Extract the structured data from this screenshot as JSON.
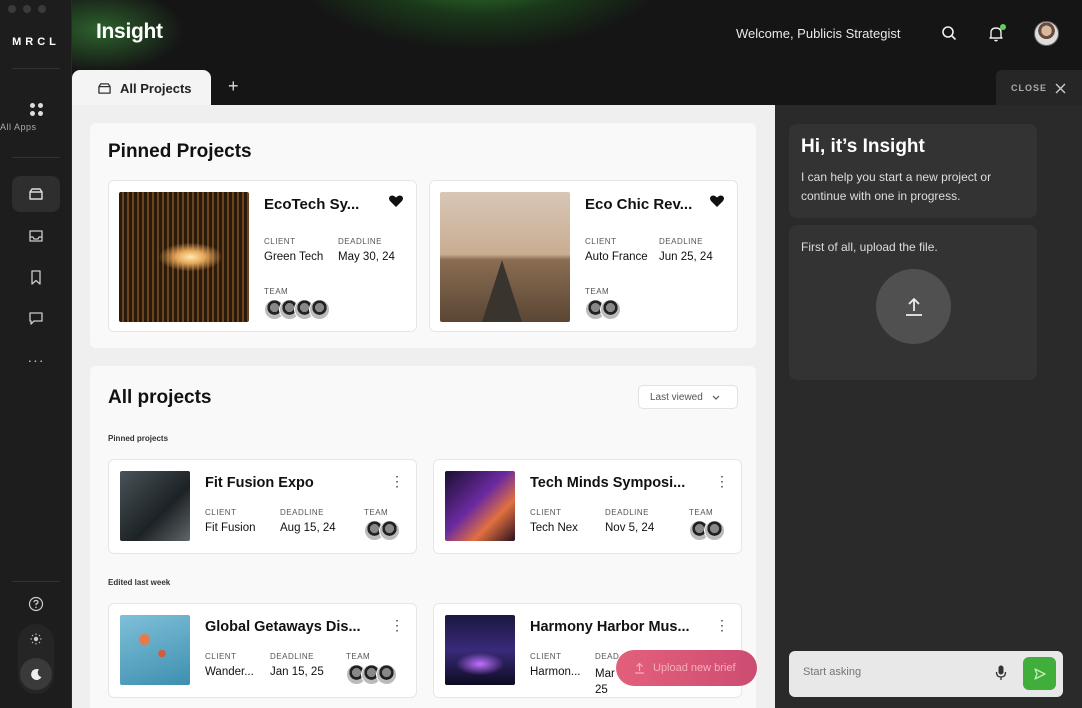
{
  "app": {
    "logo": "MRCL",
    "title": "Insight",
    "welcome": "Welcome, Publicis Strategist"
  },
  "sidebar": {
    "all_apps_label": "All Apps"
  },
  "tabs": {
    "active_label": "All Projects",
    "add_label": "+",
    "close_label": "CLOSE"
  },
  "pinned": {
    "heading": "Pinned Projects",
    "cards": [
      {
        "name": "EcoTech Sy...",
        "client_label": "CLIENT",
        "client": "Green Tech",
        "deadline_label": "DEADLINE",
        "deadline": "May 30, 24",
        "team_label": "TEAM"
      },
      {
        "name": "Eco Chic Rev...",
        "client_label": "CLIENT",
        "client": "Auto France",
        "deadline_label": "DEADLINE",
        "deadline": "Jun 25, 24",
        "team_label": "TEAM"
      }
    ]
  },
  "all_projects": {
    "heading": "All projects",
    "sort_label": "Last viewed",
    "pinned_section_label": "Pinned projects",
    "edited_section_label": "Edited last week",
    "cards": [
      {
        "name": "Fit Fusion Expo",
        "client_label": "CLIENT",
        "client": "Fit Fusion",
        "deadline_label": "DEADLINE",
        "deadline": "Aug 15, 24",
        "team_label": "TEAM"
      },
      {
        "name": "Tech Minds Symposi...",
        "client_label": "CLIENT",
        "client": "Tech Nex",
        "deadline_label": "DEADLINE",
        "deadline": "Nov 5, 24",
        "team_label": "TEAM"
      },
      {
        "name": "Global Getaways Dis...",
        "client_label": "CLIENT",
        "client": "Wander...",
        "deadline_label": "DEADLINE",
        "deadline": "Jan 15, 25",
        "team_label": "TEAM"
      },
      {
        "name": "Harmony Harbor Mus...",
        "client_label": "CLIENT",
        "client": "Harmon...",
        "deadline_label": "DEAD",
        "deadline": "Mar 25",
        "team_label": ""
      }
    ]
  },
  "upload_brief_label": "Upload new brief",
  "assistant": {
    "greeting": "Hi, it’s Insight",
    "intro": "I can help you start a new project or continue with one in progress.",
    "upload_prompt": "First of all, upload the file.",
    "input_placeholder": "Start asking"
  },
  "colors": {
    "accent_green": "#3fae3a",
    "brief_pink": "#d63d63",
    "notification": "#5fd05a"
  }
}
